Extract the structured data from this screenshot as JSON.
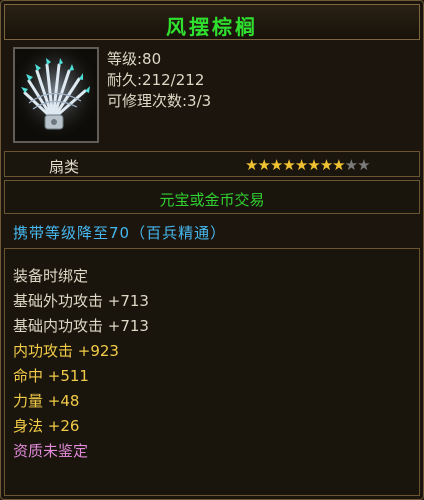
{
  "item": {
    "name": "风摆棕榈",
    "level": "等级:80",
    "durability": "耐久:212/212",
    "repairs": "可修理次数:3/3",
    "type": "扇类",
    "stars": {
      "filled": 8,
      "total": 10
    },
    "trade": "元宝或金币交易",
    "requirement": "携带等级降至70（百兵精通）",
    "attributes": [
      "装备时绑定",
      "基础外功攻击 +713",
      "基础内功攻击 +713",
      "内功攻击 +923",
      "命中 +511",
      "力量 +48",
      "身法 +26",
      "资质未鉴定"
    ]
  },
  "colors": {
    "name": "#2fe02f",
    "requirement": "#46b7ef",
    "star_on": "#f1c232",
    "star_off": "#7b7b7b",
    "highlight": "#f2cc49",
    "unidentified": "#e08ad8"
  },
  "icons": {
    "item_icon": "crystal-fan-icon",
    "star": "star-icon"
  }
}
